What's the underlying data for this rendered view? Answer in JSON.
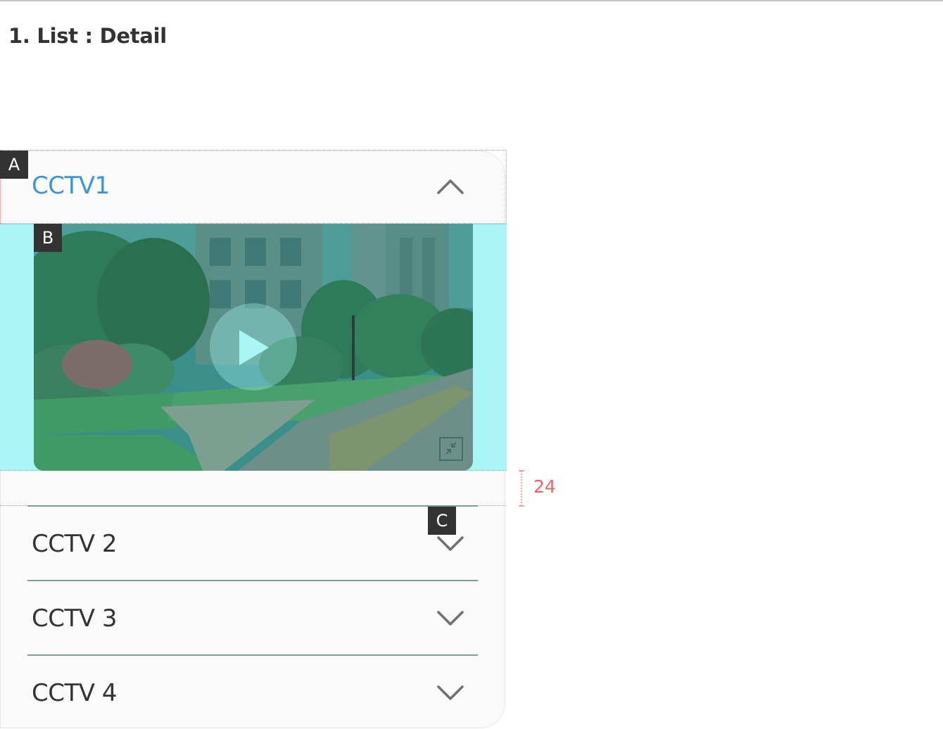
{
  "page": {
    "title": "1. List : Detail"
  },
  "annotations": {
    "badge_a": "A",
    "badge_b": "B",
    "badge_c": "C",
    "spacing_value": "24"
  },
  "accordion": {
    "items": [
      {
        "label": "CCTV1",
        "expanded": true
      },
      {
        "label": "CCTV 2",
        "expanded": false
      },
      {
        "label": "CCTV 3",
        "expanded": false
      },
      {
        "label": "CCTV 4",
        "expanded": false
      }
    ]
  },
  "video": {
    "icons": [
      "play-icon",
      "collapse-icon"
    ]
  },
  "colors": {
    "active_title": "#3a96d6",
    "highlight": "#aaf6f6",
    "annotation_red": "#f06262",
    "divider": "#7a9f93",
    "badge_bg": "#333333"
  }
}
